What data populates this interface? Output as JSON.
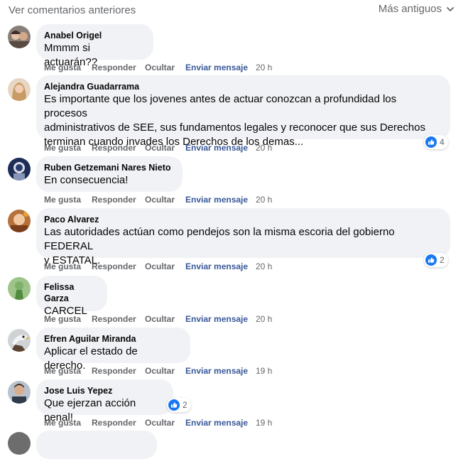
{
  "header": {
    "prev_comments": "Ver comentarios anteriores",
    "sort": "Más antiguos",
    "sort_icon": "chevron-down-icon"
  },
  "actions": {
    "like": "Me gusta",
    "reply": "Responder",
    "hide": "Ocultar",
    "message": "Enviar mensaje"
  },
  "reaction_icon": "like-icon",
  "colors": {
    "bubble": "#f0f2f5",
    "meta": "#65676b",
    "link": "#385898",
    "like_blue": "#1877f2"
  },
  "comments": [
    {
      "author": "Anabel Origel",
      "lines": [
        "Mmmm si actuarán??"
      ],
      "time": "20 h",
      "reactions": null
    },
    {
      "author": "Alejandra Guadarrama",
      "lines": [
        "Es importante que los jovenes antes de actuar conozcan a profundidad los procesos",
        "administrativos de SEE, sus fundamentos legales y reconocer que sus Derechos",
        "terminan cuando invades los Derechos de los demas..."
      ],
      "time": "20 h",
      "reactions": "4"
    },
    {
      "author": "Ruben Getzemani Nares Nieto",
      "lines": [
        "En consecuencia!"
      ],
      "time": "20 h",
      "reactions": null
    },
    {
      "author": "Paco Alvarez",
      "lines": [
        "Las autoridades actúan como pendejos son la misma escoria del gobierno FEDERAL",
        "y ESTATAL."
      ],
      "time": "20 h",
      "reactions": "2"
    },
    {
      "author": "Felissa Garza",
      "lines": [
        "CARCEL"
      ],
      "time": "20 h",
      "reactions": null
    },
    {
      "author": "Efren Aguilar Miranda",
      "lines": [
        "Aplicar el estado de derecho."
      ],
      "time": "19 h",
      "reactions": null
    },
    {
      "author": "Jose Luis Yepez",
      "lines": [
        "Que ejerzan acción penal!"
      ],
      "time": "19 h",
      "reactions": "2"
    }
  ]
}
